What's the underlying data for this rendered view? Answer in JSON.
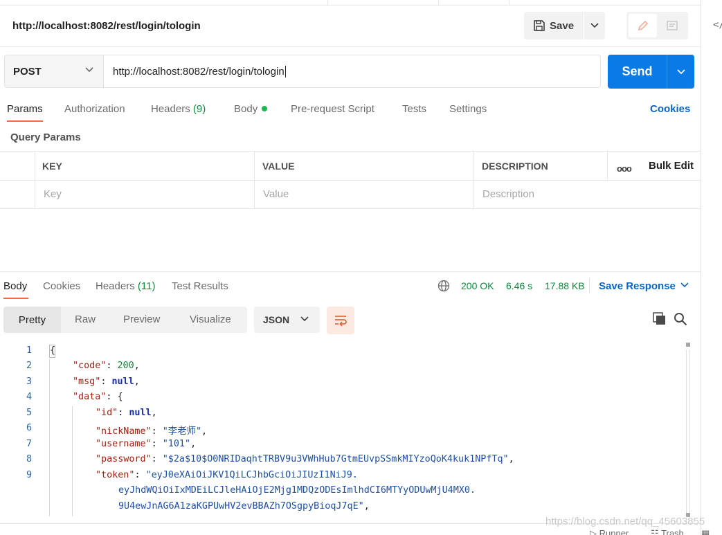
{
  "request": {
    "title": "http://localhost:8082/rest/login/tologin",
    "method": "POST",
    "url": "http://localhost:8082/rest/login/tologin"
  },
  "header": {
    "save_label": "Save",
    "send_label": "Send"
  },
  "request_tabs": {
    "params": "Params",
    "authorization": "Authorization",
    "headers": "Headers",
    "headers_count": "(9)",
    "body": "Body",
    "prerequest": "Pre-request Script",
    "tests": "Tests",
    "settings": "Settings",
    "cookies": "Cookies"
  },
  "query_params": {
    "title": "Query Params",
    "columns": {
      "key": "KEY",
      "value": "VALUE",
      "description": "DESCRIPTION"
    },
    "placeholders": {
      "key": "Key",
      "value": "Value",
      "description": "Description"
    },
    "more_options": "ooo",
    "bulk_edit": "Bulk Edit"
  },
  "response_tabs": {
    "body": "Body",
    "cookies": "Cookies",
    "headers": "Headers",
    "headers_count": "(11)",
    "test_results": "Test Results"
  },
  "response_status": {
    "code": "200 OK",
    "time": "6.46 s",
    "size": "17.88 KB",
    "save_response": "Save Response"
  },
  "view_modes": {
    "pretty": "Pretty",
    "raw": "Raw",
    "preview": "Preview",
    "visualize": "Visualize",
    "format": "JSON"
  },
  "code": {
    "line_numbers": [
      "1",
      "2",
      "3",
      "4",
      "5",
      "6",
      "7",
      "8",
      "9"
    ],
    "open_brace": "{",
    "code_key": "\"code\"",
    "code_val": "200",
    "msg_key": "\"msg\"",
    "msg_val": "null",
    "data_key": "\"data\"",
    "data_open": "{",
    "id_key": "\"id\"",
    "id_val": "null",
    "nick_key": "\"nickName\"",
    "nick_val": "\"李老师\"",
    "username_key": "\"username\"",
    "username_val": "\"101\"",
    "password_key": "\"password\"",
    "password_val": "\"$2a$10$O0NRIDaqhtTRBV9u3VWhHub7GtmEUvpSSmkMIYzoQoK4kuk1NPfTq\"",
    "token_key": "\"token\"",
    "token_val_1": "\"eyJ0eXAiOiJKV1QiLCJhbGciOiJIUzI1NiJ9.",
    "token_val_2": "eyJhdWQiOiIxMDEiLCJleHAiOjE2Mjg1MDQzODEsImlhdCI6MTYyODUwMjU4MX0.",
    "token_val_3": "9U4ewJnAG6A1zaKGPUwHV2evBBAZh7OSgpyBioqJ7qE\""
  },
  "footer": {
    "runner": "Runner",
    "trash": "Trash",
    "watermark": "https://blog.csdn.net/qq_45603855"
  },
  "colors": {
    "accent_orange": "#f26b3a",
    "send_blue": "#0a7ae6",
    "status_green": "#0c8a3a",
    "link_blue": "#0b65c2"
  }
}
